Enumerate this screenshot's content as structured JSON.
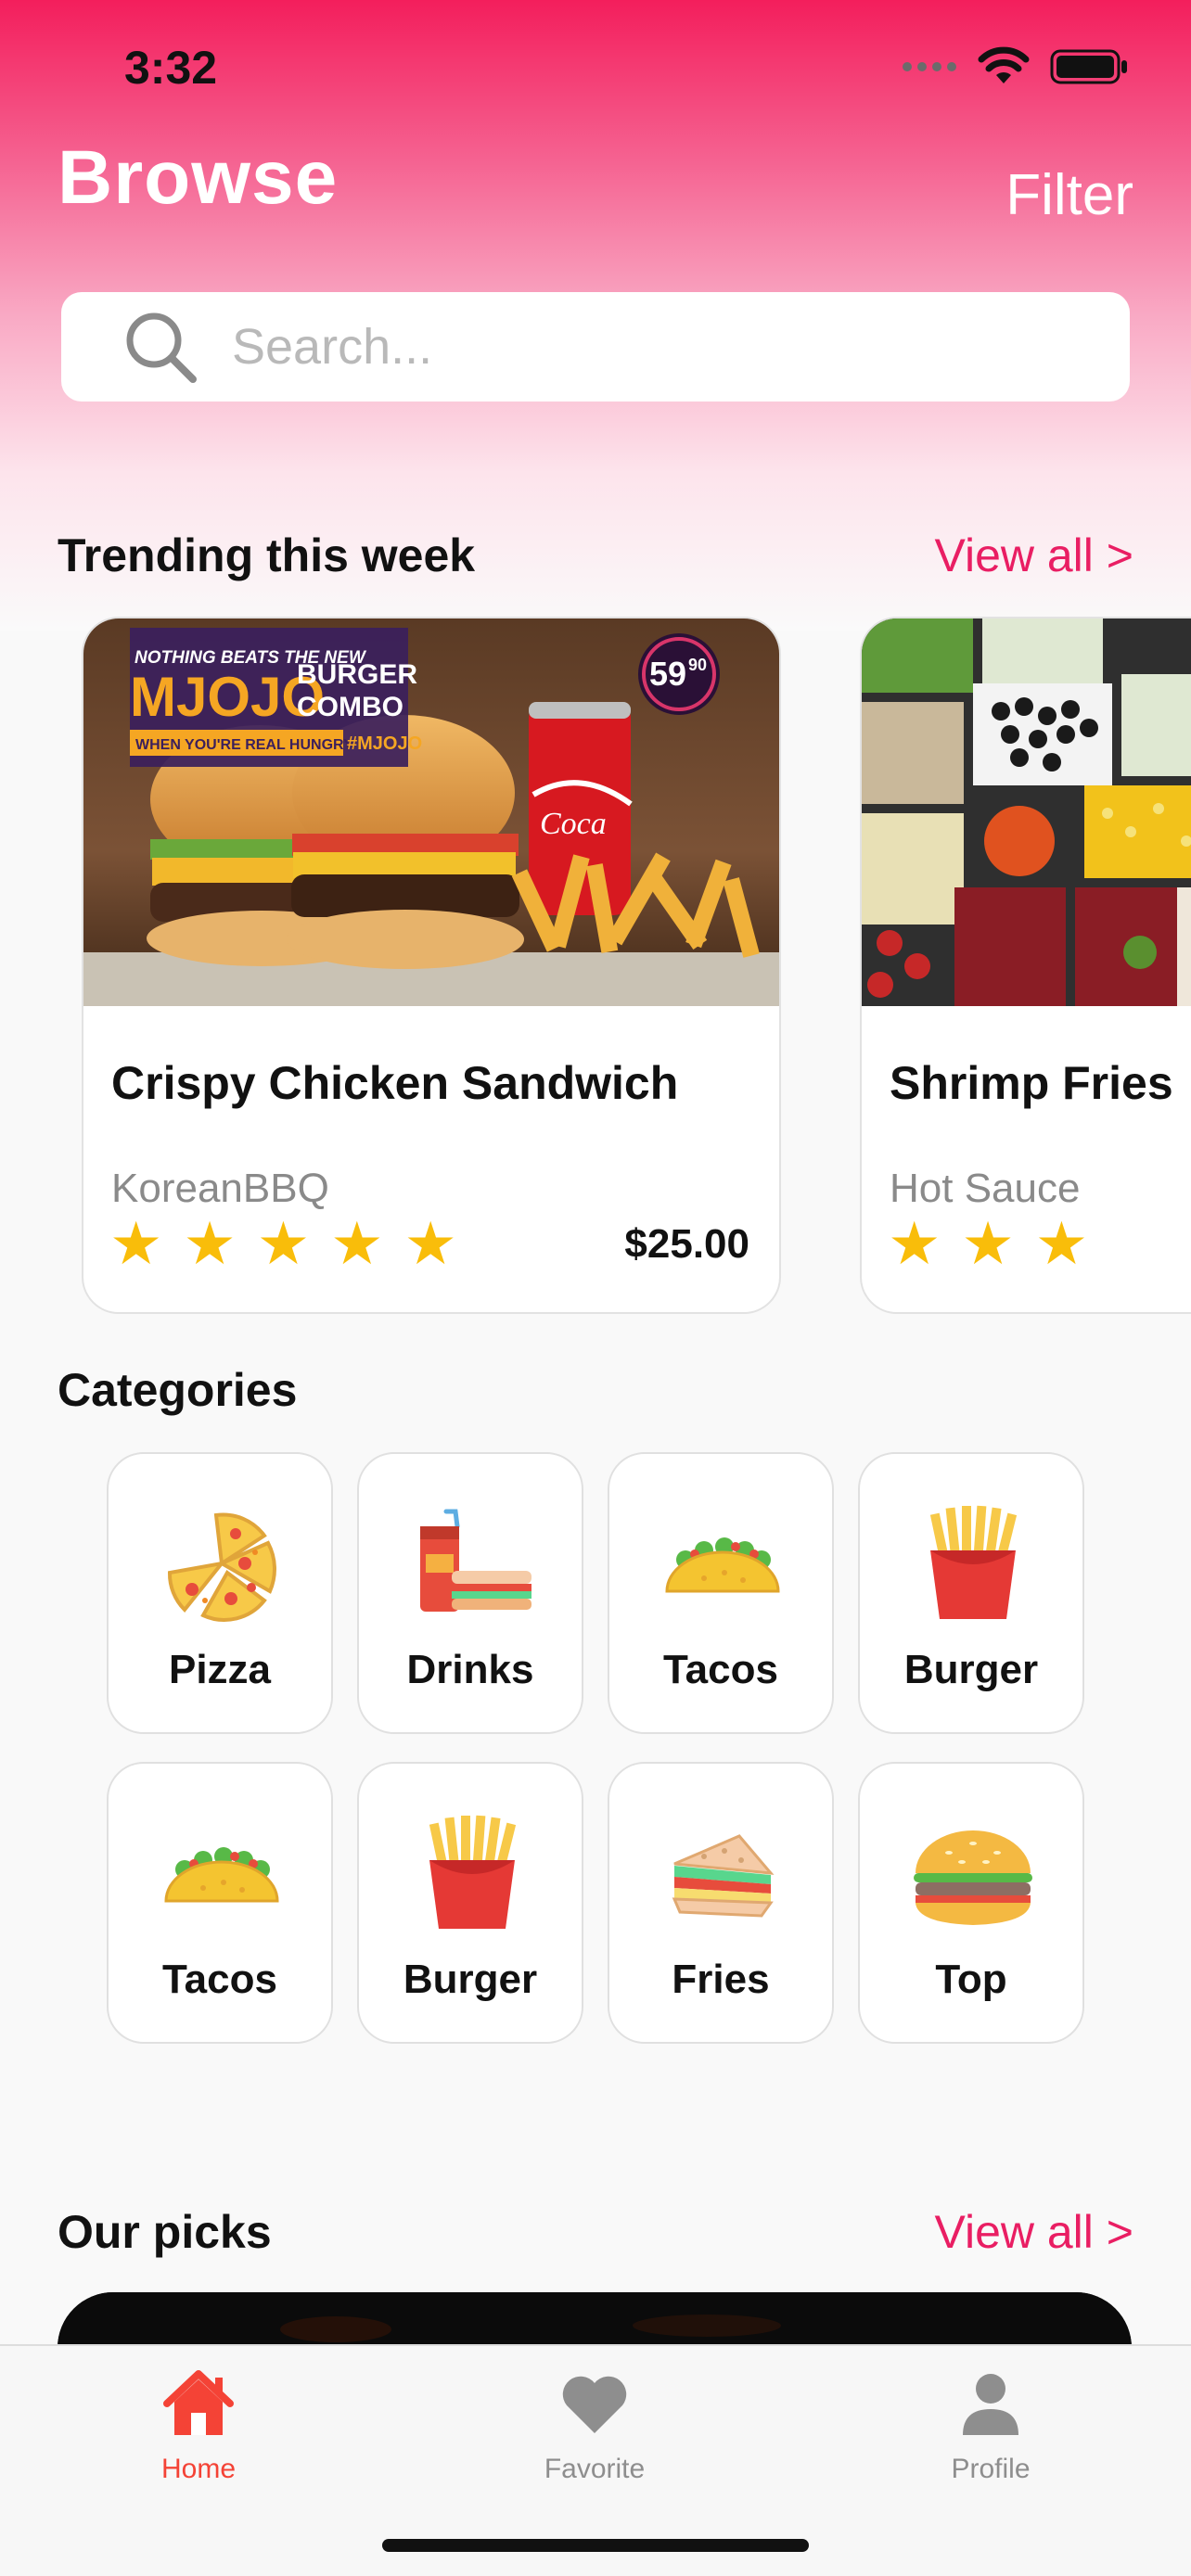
{
  "status_bar": {
    "time": "3:32"
  },
  "header": {
    "title": "Browse",
    "filter_label": "Filter"
  },
  "search": {
    "placeholder": "Search..."
  },
  "trending": {
    "title": "Trending this week",
    "view_all": "View all >",
    "items": [
      {
        "name": "Crispy Chicken Sandwich",
        "subtitle": "KoreanBBQ",
        "rating": 5,
        "price": "$25.00"
      },
      {
        "name": "Shrimp Fries",
        "subtitle": "Hot Sauce",
        "rating": 3,
        "price": ""
      }
    ],
    "promo": {
      "line1": "NOTHING BEATS THE NEW",
      "brand": "MJOJO",
      "line2": "BURGER",
      "line3": "COMBO",
      "line4": "WHEN YOU'RE REAL HUNGRY",
      "hashtag": "#MJOJO",
      "price_badge": "59",
      "price_badge_sup": "90"
    }
  },
  "categories": {
    "title": "Categories",
    "items": [
      {
        "label": "Pizza",
        "icon": "pizza-icon"
      },
      {
        "label": "Drinks",
        "icon": "drinks-icon"
      },
      {
        "label": "Tacos",
        "icon": "taco-icon"
      },
      {
        "label": "Burger",
        "icon": "fries-icon"
      },
      {
        "label": "Tacos",
        "icon": "taco-icon"
      },
      {
        "label": "Burger",
        "icon": "fries-icon"
      },
      {
        "label": "Fries",
        "icon": "sandwich-icon"
      },
      {
        "label": "Top",
        "icon": "burger-icon"
      }
    ]
  },
  "picks": {
    "title": "Our picks",
    "view_all": "View all >"
  },
  "tab_bar": {
    "active_color": "#f44336",
    "inactive_color": "#8e8e8e",
    "tabs": [
      {
        "label": "Home",
        "icon": "home-icon",
        "active": true
      },
      {
        "label": "Favorite",
        "icon": "heart-icon",
        "active": false
      },
      {
        "label": "Profile",
        "icon": "person-icon",
        "active": false
      }
    ]
  },
  "colors": {
    "accent": "#e91e63",
    "gradient_top": "#f31e5c",
    "star": "#f9bd0a"
  }
}
